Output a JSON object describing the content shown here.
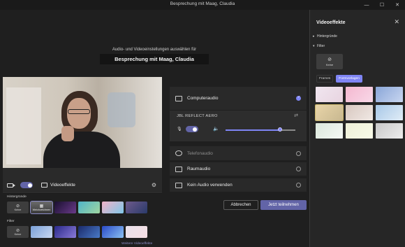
{
  "window": {
    "title": "Besprechung mit Maag, Claudia",
    "controls": [
      "—",
      "☐",
      "✕"
    ]
  },
  "prejoin": {
    "instruction": "Audio- und Videoeinstellungen auswählen für",
    "meeting_title": "Besprechung mit Maag, Claudia"
  },
  "video": {
    "camera_on": true,
    "effects_label": "Videoeffekte",
    "backgrounds_label": "Hintergründe",
    "filter_label": "Filter",
    "none_label": "Keine",
    "blur_label": "Weichzeichnen",
    "more_link": "Weitere Videoeffekte",
    "background_thumbs": [
      {
        "kind": "none"
      },
      {
        "kind": "blur",
        "selected": true
      },
      {
        "colors": [
          "#1a1030",
          "#6a3a8a"
        ]
      },
      {
        "colors": [
          "#4fb3c8",
          "#a0d6a0"
        ]
      },
      {
        "colors": [
          "#f2b2c8",
          "#7fc7e8"
        ]
      },
      {
        "colors": [
          "#6e5a8c",
          "#2a3a6a"
        ]
      }
    ],
    "filter_thumbs": [
      {
        "kind": "none"
      },
      {
        "colors": [
          "#7aa0d8",
          "#c9d8f0"
        ]
      },
      {
        "colors": [
          "#2a2a8a",
          "#8a7ad8"
        ]
      },
      {
        "colors": [
          "#1a2a6a",
          "#4a7ac8"
        ]
      },
      {
        "colors": [
          "#2a4ac8",
          "#8ac0f0"
        ]
      },
      {
        "colors": [
          "#e8e0ea",
          "#f6dfe4"
        ]
      }
    ]
  },
  "audio": {
    "computer_audio": "Computeraudio",
    "device_name": "JBL REFLECT AERO",
    "mic_on": true,
    "speaker_volume": 0.8,
    "phone_audio": "Telefonaudio",
    "room_audio": "Raumaudio",
    "no_audio": "Kein Audio verwenden"
  },
  "buttons": {
    "cancel": "Abbrechen",
    "join": "Jetzt teilnehmen"
  },
  "side_panel": {
    "title": "Videoeffekte",
    "backgrounds": "Hintergründe",
    "filter": "Filter",
    "none_label": "Keine",
    "tabs": [
      "Frames",
      "Formvorlagen"
    ],
    "active_tab": "Formvorlagen",
    "style_thumbs": [
      {
        "colors": [
          "#f0e6f0",
          "#e8d4e0"
        ]
      },
      {
        "colors": [
          "#f4b8d0",
          "#f8d8e8"
        ]
      },
      {
        "colors": [
          "#8aa6d8",
          "#c8d6f0"
        ]
      },
      {
        "colors": [
          "#e8d4a8",
          "#c8b890"
        ],
        "selected": true
      },
      {
        "colors": [
          "#d8c8c0",
          "#f0e8e4"
        ]
      },
      {
        "colors": [
          "#a8c8e8",
          "#e0ecf6"
        ]
      },
      {
        "colors": [
          "#dce8dc",
          "#f4f8f4"
        ]
      },
      {
        "colors": [
          "#eef0d8",
          "#f8fae8"
        ]
      },
      {
        "colors": [
          "#c8c8c8",
          "#ececec"
        ]
      }
    ]
  }
}
